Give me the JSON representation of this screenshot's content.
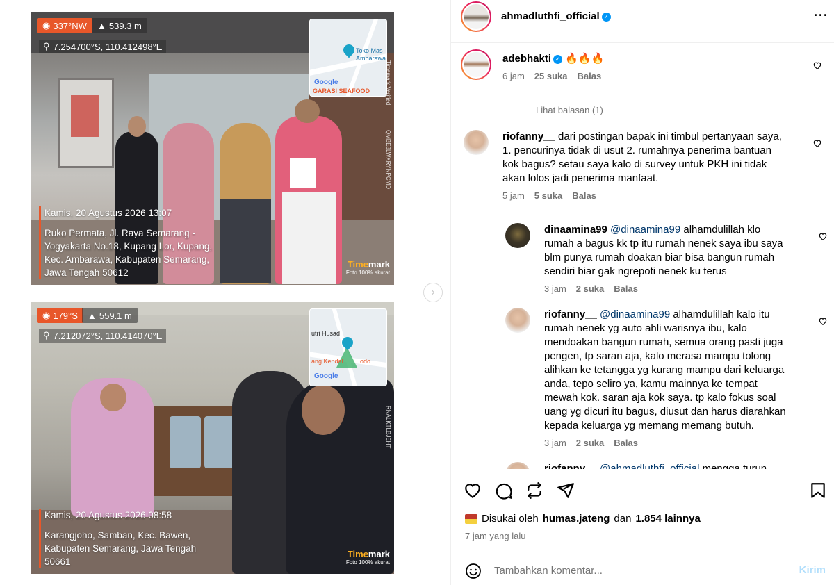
{
  "photos": [
    {
      "heading": "337°NW",
      "altitude": "539.3 m",
      "coords": "7.254700°S, 110.412498°E",
      "map_labels": [
        "Toko Mas",
        "Ambarawa",
        "GARASI SEAFOOD"
      ],
      "map_google": "Google",
      "datetime": "Kamis, 20 Agustus 2026 13:07",
      "address": [
        "Ruko Permata, Jl. Raya Semarang -",
        "Yogyakarta No.18, Kupang Lor, Kupang,",
        "Kec. Ambarawa, Kabupaten Semarang,",
        "Jawa Tengah 50612"
      ],
      "brand_a": "Time",
      "brand_b": "mark",
      "brand_sub": "Foto 100% akurat",
      "vertical_code": "QMBE8LWXRYNPCMD",
      "vertical_note": "Timemark Verified"
    },
    {
      "heading": "179°S",
      "altitude": "559.1 m",
      "coords": "7.212072°S, 110.414070°E",
      "map_labels": [
        "utri Husad",
        "ang Kendal",
        "odo"
      ],
      "map_google": "Google",
      "datetime": "Kamis, 20 Agustus 2026 08:58",
      "address": [
        "Karangjoho, Samban, Kec. Bawen,",
        "Kabupaten Semarang, Jawa Tengah",
        "50661"
      ],
      "brand_a": "Time",
      "brand_b": "mark",
      "brand_sub": "Foto 100% akurat",
      "vertical_code": "RNALKTLBJEHT"
    }
  ],
  "post": {
    "author": "ahmadluthfi_official",
    "more_icon": "more-horizontal-icon"
  },
  "comments": [
    {
      "user": "adebhakti",
      "verified": true,
      "text": "🔥🔥🔥",
      "time": "6 jam",
      "likes": "25 suka",
      "reply": "Balas"
    },
    {
      "user": "riofanny__",
      "text_lines": [
        "dari postingan bapak ini timbul pertanyaan saya,",
        "1. pencurinya tidak di usut 2. rumahnya penerima bantuan",
        "kok bagus? setau saya kalo di survey untuk PKH ini tidak",
        "akan lolos jadi penerima manfaat."
      ],
      "time": "5 jam",
      "likes": "5 suka",
      "reply": "Balas"
    },
    {
      "user": "dinaamina99",
      "mention": "@dinaamina99",
      "text_lines": [
        "alhamdulillah klo",
        "rumah a bagus kk tp itu rumah nenek saya ibu saya",
        "blm punya rumah doakan biar bisa bangun rumah",
        "sendiri biar gak ngrepoti nenek ku terus"
      ],
      "time": "3 jam",
      "likes": "2 suka",
      "reply": "Balas"
    },
    {
      "user": "riofanny__",
      "mention": "@dinaamina99",
      "text_lines": [
        "alhamdulillah kalo itu",
        "rumah nenek yg auto ahli warisnya ibu, kalo",
        "mendoakan bangun rumah, semua orang pasti juga",
        "pengen, tp saran aja, kalo merasa mampu tolong",
        "alihkan ke tetangga yg kurang mampu dari keluarga",
        "anda, tepo seliro ya, kamu mainnya ke tempat",
        "mewah kok. saran aja kok saya. tp kalo fokus soal",
        "uang yg dicuri itu bagus, diusut dan harus diarahkan",
        "kepada keluarga yg memang memang butuh."
      ],
      "time": "3 jam",
      "likes": "2 suka",
      "reply": "Balas"
    },
    {
      "user": "riofanny__",
      "mention": "@ahmadluthfi_official",
      "text_lines": [
        "mengga turun"
      ]
    }
  ],
  "view_replies": "Lihat balasan (1)",
  "actions": {
    "liked_by_prefix": "Disukai oleh",
    "liked_by_user": "humas.jateng",
    "liked_by_conj": "dan",
    "liked_by_count": "1.854 lainnya",
    "time_ago": "7 jam yang lalu"
  },
  "comment_box": {
    "placeholder": "Tambahkan komentar...",
    "post_label": "Kirim"
  },
  "colors": {
    "accent": "#0095f6",
    "mention": "#00376b",
    "muted": "#737373",
    "timemark_orange": "#e8572a"
  }
}
